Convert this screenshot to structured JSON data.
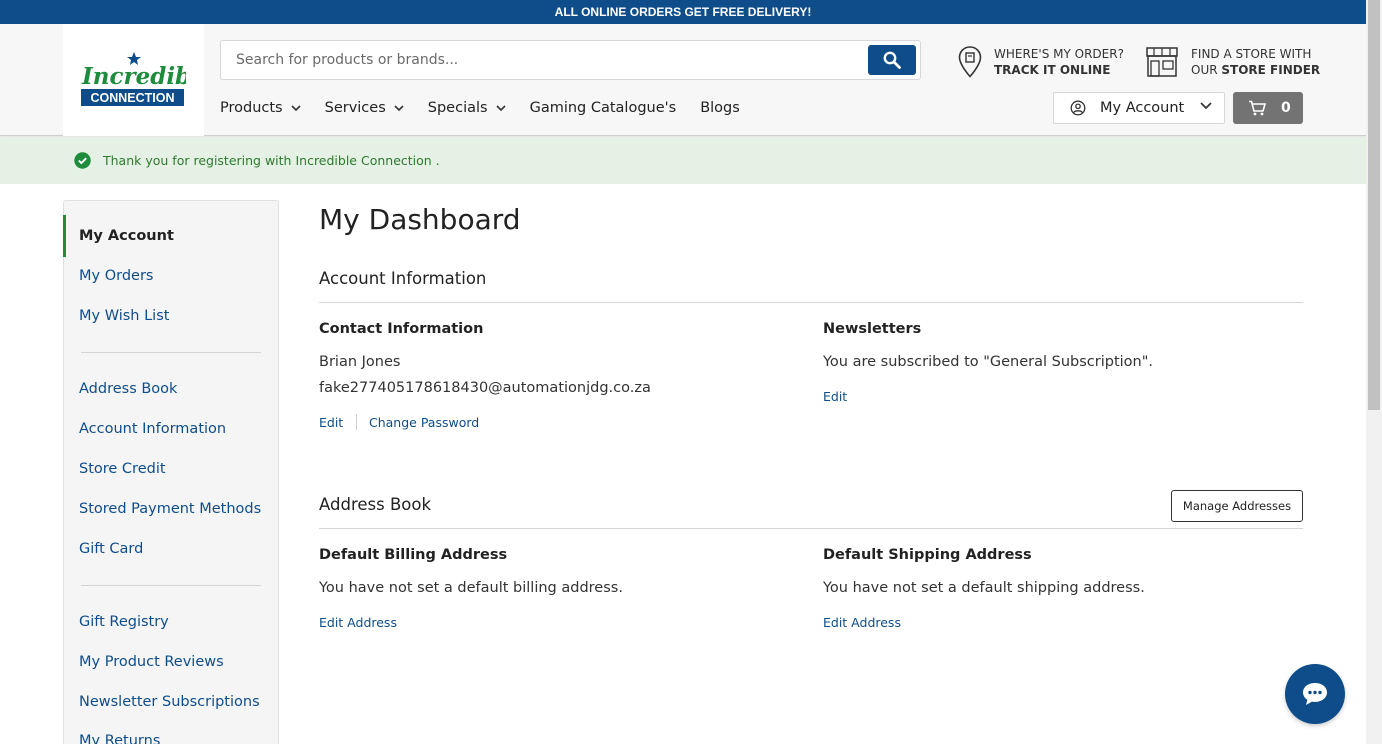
{
  "promo": {
    "text": "ALL ONLINE ORDERS GET FREE DELIVERY!"
  },
  "logo": {
    "line1": "Incredible",
    "line2": "CONNECTION"
  },
  "search": {
    "placeholder": "Search for products or brands..."
  },
  "utility": {
    "order_line1": "WHERE'S MY ORDER?",
    "order_line2": "TRACK IT ONLINE",
    "store_line1": "FIND A STORE WITH",
    "store_line2_prefix": "OUR ",
    "store_line2_bold": "STORE FINDER"
  },
  "nav": {
    "products": "Products",
    "services": "Services",
    "specials": "Specials",
    "gaming": "Gaming Catalogue's",
    "blogs": "Blogs"
  },
  "account": {
    "label": "My Account"
  },
  "cart": {
    "count": "0"
  },
  "message": {
    "text": "Thank you for registering with Incredible Connection ."
  },
  "sidebar": {
    "items": [
      "My Account",
      "My Orders",
      "My Wish List",
      "Address Book",
      "Account Information",
      "Store Credit",
      "Stored Payment Methods",
      "Gift Card",
      "Gift Registry",
      "My Product Reviews",
      "Newsletter Subscriptions",
      "My Returns"
    ]
  },
  "dashboard": {
    "title": "My Dashboard",
    "account_info_title": "Account Information",
    "contact_title": "Contact Information",
    "name": "Brian Jones",
    "email": "fake277405178618430@automationjdg.co.za",
    "edit": "Edit",
    "change_password": "Change Password",
    "newsletters_title": "Newsletters",
    "newsletters_text": "You are subscribed to \"General Subscription\".",
    "newsletters_edit": "Edit",
    "address_book_title": "Address Book",
    "manage_addresses": "Manage Addresses",
    "billing_title": "Default Billing Address",
    "billing_text": "You have not set a default billing address.",
    "billing_edit": "Edit Address",
    "shipping_title": "Default Shipping Address",
    "shipping_text": "You have not set a default shipping address.",
    "shipping_edit": "Edit Address"
  },
  "colors": {
    "brand_blue": "#0f4d8a",
    "success_green": "#1e8c3c",
    "message_bg": "#e4f1e4"
  }
}
